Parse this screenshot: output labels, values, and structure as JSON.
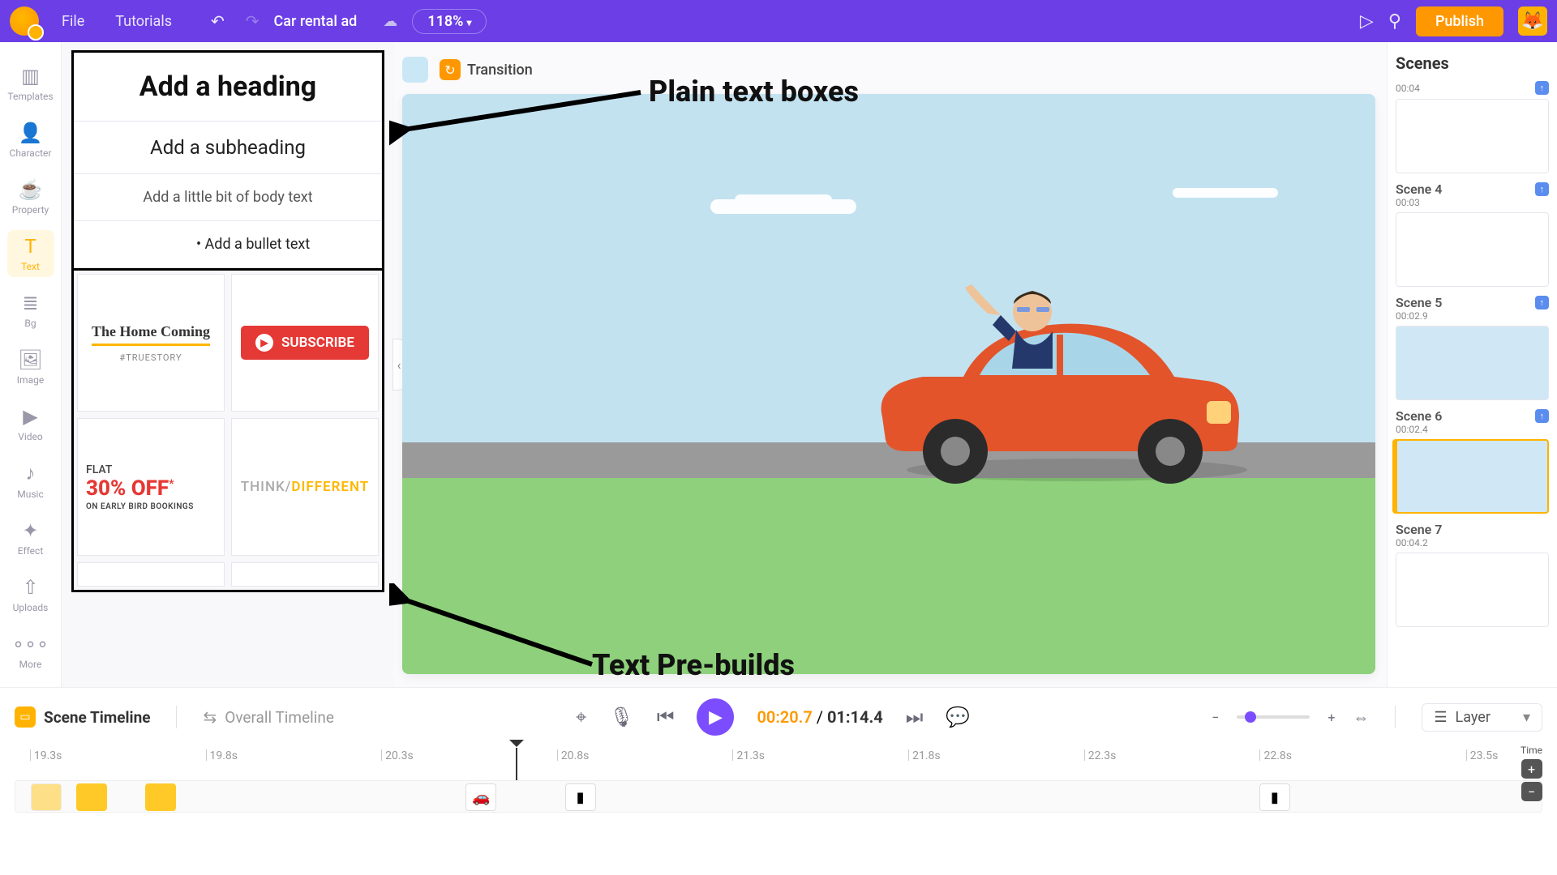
{
  "project": {
    "title": "Car rental ad"
  },
  "topmenu": {
    "file": "File",
    "tutorials": "Tutorials",
    "zoom": "118%",
    "publish": "Publish"
  },
  "rail": {
    "templates": "Templates",
    "character": "Character",
    "property": "Property",
    "text": "Text",
    "bg": "Bg",
    "image": "Image",
    "video": "Video",
    "music": "Music",
    "effect": "Effect",
    "uploads": "Uploads",
    "more": "More"
  },
  "textPanel": {
    "heading": "Add a heading",
    "subheading": "Add a subheading",
    "body": "Add a little bit of body text",
    "bullet": "Add a bullet text",
    "pb1a": "The Home Coming",
    "pb1b": "#TRUESTORY",
    "pb2": "SUBSCRIBE",
    "pb3a": "FLAT",
    "pb3b": "30% OFF",
    "pb3c": "ON EARLY BIRD BOOKINGS",
    "pb4a": "THINK/",
    "pb4b": "DIFFERENT"
  },
  "canvasTop": {
    "transition": "Transition"
  },
  "scenes": {
    "title": "Scenes",
    "topTime": "00:04",
    "list": [
      {
        "name": "Scene 4",
        "time": "00:03"
      },
      {
        "name": "Scene 5",
        "time": "00:02.9"
      },
      {
        "name": "Scene 6",
        "time": "00:02.4"
      },
      {
        "name": "Scene 7",
        "time": "00:04.2"
      }
    ]
  },
  "timeline": {
    "sceneTimeline": "Scene Timeline",
    "overallTimeline": "Overall Timeline",
    "current": "00:20.7",
    "total": "01:14.4",
    "layer": "Layer",
    "timeLabel": "Time",
    "ticks": [
      "19.3s",
      "19.8s",
      "20.3s",
      "20.8s",
      "21.3s",
      "21.8s",
      "22.3s",
      "22.8s",
      "23.5s"
    ]
  },
  "annotations": {
    "plain": "Plain text boxes",
    "prebuilds": "Text Pre-builds"
  }
}
